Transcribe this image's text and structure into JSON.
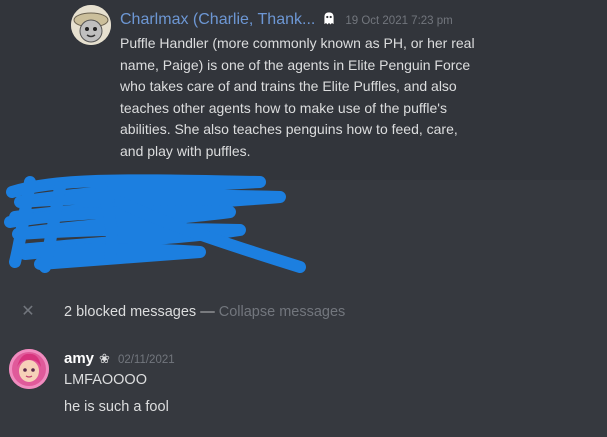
{
  "top_message": {
    "username": "Charlmax (Charlie, Thank...",
    "badge_icon": "ghost-icon",
    "timestamp": "19 Oct 2021 7:23 pm",
    "content": "Puffle Handler (more commonly known as PH, or her real name, Paige) is one of the agents in Elite Penguin Force who takes care of and trains the Elite Puffles, and also teaches other agents how to make use of the puffle's abilities. She also teaches penguins how to feed, care, and play with puffles.",
    "username_color": "#6d97d4"
  },
  "redaction": {
    "color": "#1c7fe0"
  },
  "blocked": {
    "label": "2 blocked messages",
    "separator": "—",
    "collapse": "Collapse messages"
  },
  "amy_message": {
    "username": "amy",
    "flower": "❀",
    "timestamp": "02/11/2021",
    "lines": [
      "LMFAOOOO",
      "he is such a fool"
    ]
  },
  "colors": {
    "background": "#36393f",
    "highlight": "#32353b",
    "text": "#dcddde",
    "muted": "#72767d"
  }
}
